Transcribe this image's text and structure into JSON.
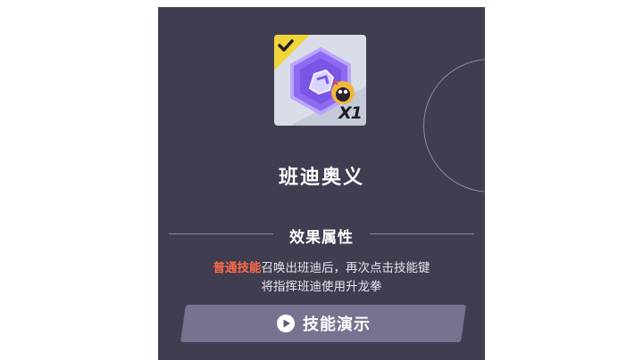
{
  "skill": {
    "name": "班迪奥义",
    "count": "X1",
    "equipped": true,
    "icon": "bandi-skill-badge-icon",
    "accent_color": "#8c6bf0"
  },
  "effects": {
    "title": "效果属性",
    "highlight": "普通技能",
    "line1": "召唤出班迪后，再次点击技能键",
    "line2": "将指挥班迪使用升龙拳"
  },
  "demo_button": {
    "label": "技能演示",
    "icon": "play-circle-icon"
  }
}
